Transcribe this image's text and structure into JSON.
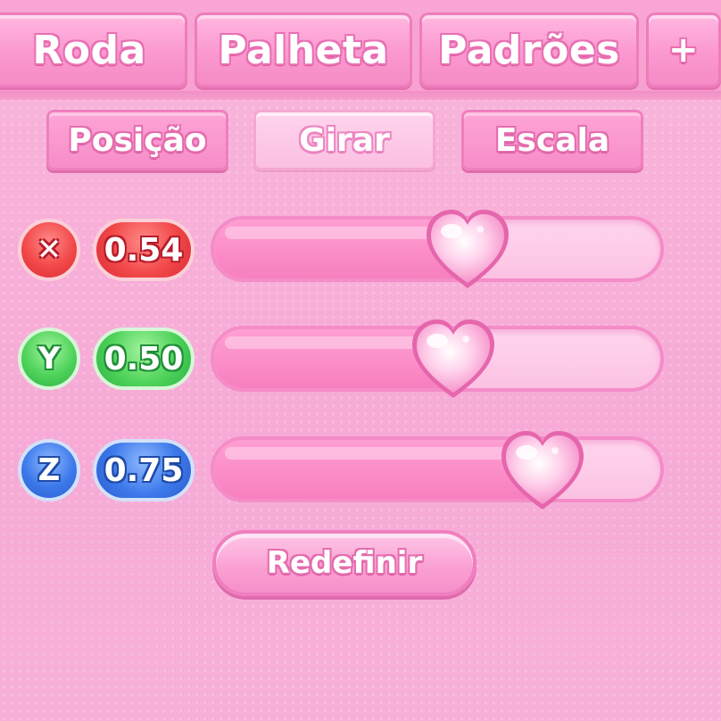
{
  "tabs": [
    {
      "label": "Roda"
    },
    {
      "label": "Palheta"
    },
    {
      "label": "Padrões"
    },
    {
      "label": "+"
    }
  ],
  "subtabs": [
    {
      "label": "Posição",
      "active": false
    },
    {
      "label": "Girar",
      "active": true
    },
    {
      "label": "Escala",
      "active": false
    }
  ],
  "sliders": [
    {
      "axis": "X",
      "value_text": "0.54",
      "value": 0.54,
      "color": "#f24848",
      "glyph": "✕"
    },
    {
      "axis": "Y",
      "value_text": "0.50",
      "value": 0.5,
      "color": "#4fd35a",
      "glyph": "Y"
    },
    {
      "axis": "Z",
      "value_text": "0.75",
      "value": 0.75,
      "color": "#3c79ea",
      "glyph": "Z"
    }
  ],
  "reset_label": "Redefinir",
  "theme": {
    "accent": "#f77fbf",
    "background": "#f7aed8",
    "knob": "heart-icon"
  }
}
